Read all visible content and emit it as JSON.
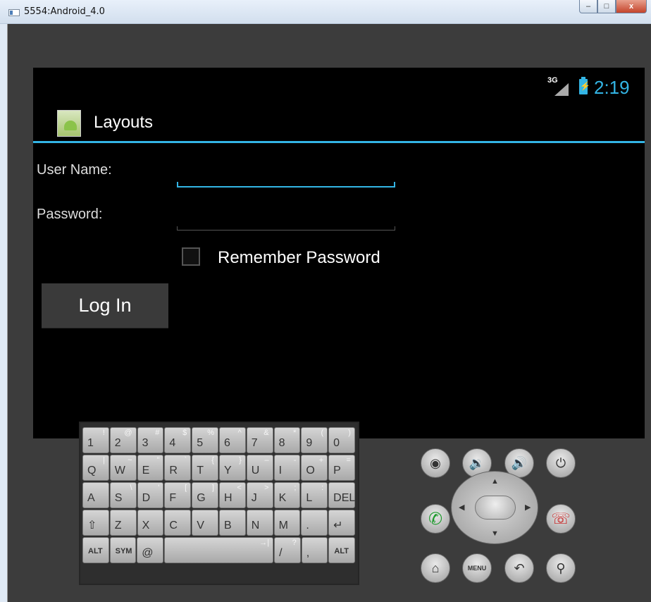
{
  "window": {
    "title": "5554:Android_4.0",
    "controls": {
      "minimize": "–",
      "maximize": "□",
      "close": "x"
    }
  },
  "status_bar": {
    "network": "3G",
    "clock": "2:19",
    "accent_color": "#33b5e5"
  },
  "action_bar": {
    "title": "Layouts",
    "icon": "android-app-icon"
  },
  "form": {
    "username_label": "User Name:",
    "password_label": "Password:",
    "remember_label": "Remember Password",
    "remember_checked": false,
    "login_label": "Log In"
  },
  "keyboard": {
    "rows": [
      [
        [
          "1",
          "!"
        ],
        [
          "2",
          "@"
        ],
        [
          "3",
          "#"
        ],
        [
          "4",
          "$"
        ],
        [
          "5",
          "%"
        ],
        [
          "6",
          "^"
        ],
        [
          "7",
          "&"
        ],
        [
          "8",
          "*"
        ],
        [
          "9",
          "("
        ],
        [
          "0",
          ")"
        ]
      ],
      [
        [
          "Q",
          "|"
        ],
        [
          "W",
          "~"
        ],
        [
          "E",
          "\""
        ],
        [
          "R",
          "`"
        ],
        [
          "T",
          "{"
        ],
        [
          "Y",
          "}"
        ],
        [
          "U",
          "–"
        ],
        [
          "I",
          "-"
        ],
        [
          "O",
          "+"
        ],
        [
          "P",
          "="
        ]
      ],
      [
        [
          "A",
          ""
        ],
        [
          "S",
          "\\"
        ],
        [
          "D",
          "'"
        ],
        [
          "F",
          "["
        ],
        [
          "G",
          "]"
        ],
        [
          "H",
          "<"
        ],
        [
          "J",
          ">"
        ],
        [
          "K",
          ";"
        ],
        [
          "L",
          ":"
        ],
        [
          "DEL",
          ""
        ]
      ],
      [
        [
          "⇧",
          ""
        ],
        [
          "Z",
          ""
        ],
        [
          "X",
          ""
        ],
        [
          "C",
          ""
        ],
        [
          "V",
          ""
        ],
        [
          "B",
          ""
        ],
        [
          "N",
          ""
        ],
        [
          "M",
          ""
        ],
        [
          ".",
          ""
        ],
        [
          "↵",
          ""
        ]
      ],
      [
        [
          "ALT",
          ""
        ],
        [
          "SYM",
          ""
        ],
        [
          "@",
          ""
        ],
        [
          "SPACE",
          "→|"
        ],
        [
          "/",
          "?"
        ],
        [
          ",",
          ""
        ],
        [
          "ALT",
          ""
        ]
      ]
    ]
  },
  "controls": {
    "camera": "camera-icon",
    "volume_down": "volume-down-icon",
    "volume_up": "volume-up-icon",
    "power": "power-icon",
    "call": "call-icon",
    "end_call": "end-call-icon",
    "home": "home-icon",
    "menu": "MENU",
    "back": "back-icon",
    "search": "search-icon"
  }
}
